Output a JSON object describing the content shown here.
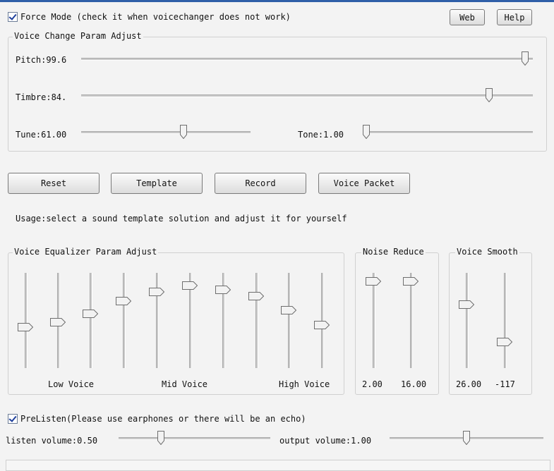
{
  "force_mode": {
    "label": "Force Mode (check it when voicechanger does not work)",
    "checked": true
  },
  "header_buttons": {
    "web": "Web",
    "help": "Help"
  },
  "voice_change": {
    "title": "Voice Change Param Adjust",
    "pitch": {
      "label": "Pitch:99.6",
      "value_fraction": 0.99
    },
    "timbre": {
      "label": "Timbre:84.",
      "value_fraction": 0.91
    },
    "tune": {
      "label": "Tune:61.00",
      "value_fraction": 0.61
    },
    "tone": {
      "label": "Tone:1.00",
      "value_fraction": 0.0
    }
  },
  "actions": {
    "reset": "Reset",
    "template": "Template",
    "record": "Record",
    "voice_packet": "Voice Packet"
  },
  "usage": "Usage:select a sound template solution and adjust it for yourself",
  "equalizer": {
    "title": "Voice Equalizer Param Adjust",
    "levels": [
      0.47,
      0.53,
      0.63,
      0.77,
      0.88,
      0.95,
      0.9,
      0.83,
      0.67,
      0.5
    ],
    "low": "Low Voice",
    "mid": "Mid Voice",
    "high": "High Voice"
  },
  "noise_reduce": {
    "title": "Noise Reduce",
    "values": [
      "2.00",
      "16.00"
    ],
    "levels": [
      1.0,
      1.0
    ]
  },
  "voice_smooth": {
    "title": "Voice Smooth",
    "values": [
      "26.00",
      "-117"
    ],
    "levels": [
      0.73,
      0.3
    ]
  },
  "prelisten": {
    "label": "PreListen(Please use earphones or there will be an echo)",
    "checked": true
  },
  "listen_volume": {
    "label": "listen volume:0.50",
    "value_fraction": 0.27
  },
  "output_volume": {
    "label": "output volume:1.00",
    "value_fraction": 0.5
  },
  "colors": {
    "thumb_fill": "#f2f2f2",
    "thumb_stroke": "#6e6e6e",
    "title_bar": "#2f5fa8"
  }
}
